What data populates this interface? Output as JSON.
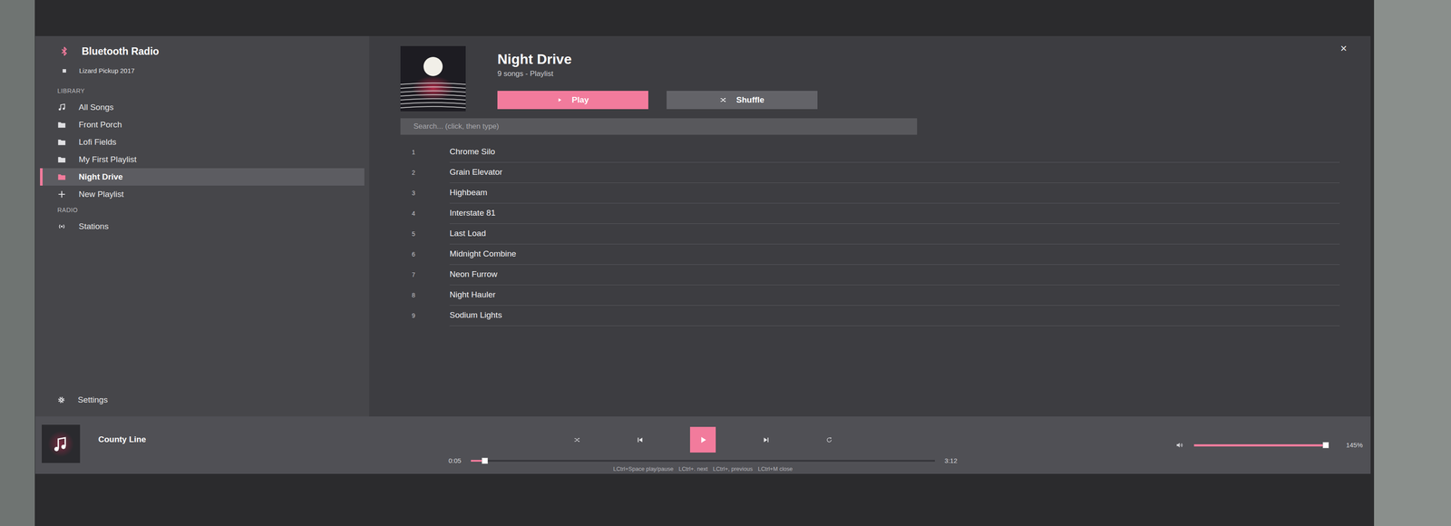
{
  "sidebar": {
    "title": "Bluetooth Radio",
    "device": "Lizard Pickup 2017",
    "library_label": "LIBRARY",
    "items": [
      {
        "label": "All Songs",
        "kind": "songs",
        "selected": false
      },
      {
        "label": "Front Porch",
        "kind": "folder",
        "selected": false
      },
      {
        "label": "Lofi Fields",
        "kind": "folder",
        "selected": false
      },
      {
        "label": "My First Playlist",
        "kind": "folder",
        "selected": false
      },
      {
        "label": "Night Drive",
        "kind": "folder",
        "selected": true
      },
      {
        "label": "New Playlist",
        "kind": "add",
        "selected": false
      }
    ],
    "radio_label": "RADIO",
    "radio_items": [
      {
        "label": "Stations",
        "kind": "radio",
        "selected": false
      }
    ],
    "settings": "Settings"
  },
  "close": "×",
  "playlist": {
    "title": "Night Drive",
    "meta": "9 songs - Playlist",
    "play": "Play",
    "shuffle": "Shuffle",
    "search_placeholder": "Search... (click, then type)",
    "tracks": [
      {
        "number": "1",
        "title": "Chrome Silo"
      },
      {
        "number": "2",
        "title": "Grain Elevator"
      },
      {
        "number": "3",
        "title": "Highbeam"
      },
      {
        "number": "4",
        "title": "Interstate 81"
      },
      {
        "number": "5",
        "title": "Last Load"
      },
      {
        "number": "6",
        "title": "Midnight Combine"
      },
      {
        "number": "7",
        "title": "Neon Furrow"
      },
      {
        "number": "8",
        "title": "Night Hauler"
      },
      {
        "number": "9",
        "title": "Sodium Lights"
      }
    ]
  },
  "player": {
    "title": "County Line",
    "playing": false,
    "shuffle_on": false,
    "repeat_on": false,
    "elapsed": "0:05",
    "duration": "3:12",
    "progress": 0.03,
    "volume": 0.98,
    "volume_reading": "145%",
    "hints": [
      "LCtrl+Space play/pause",
      "LCtrl+. next",
      "LCtrl+, previous",
      "LCtrl+M close"
    ]
  }
}
